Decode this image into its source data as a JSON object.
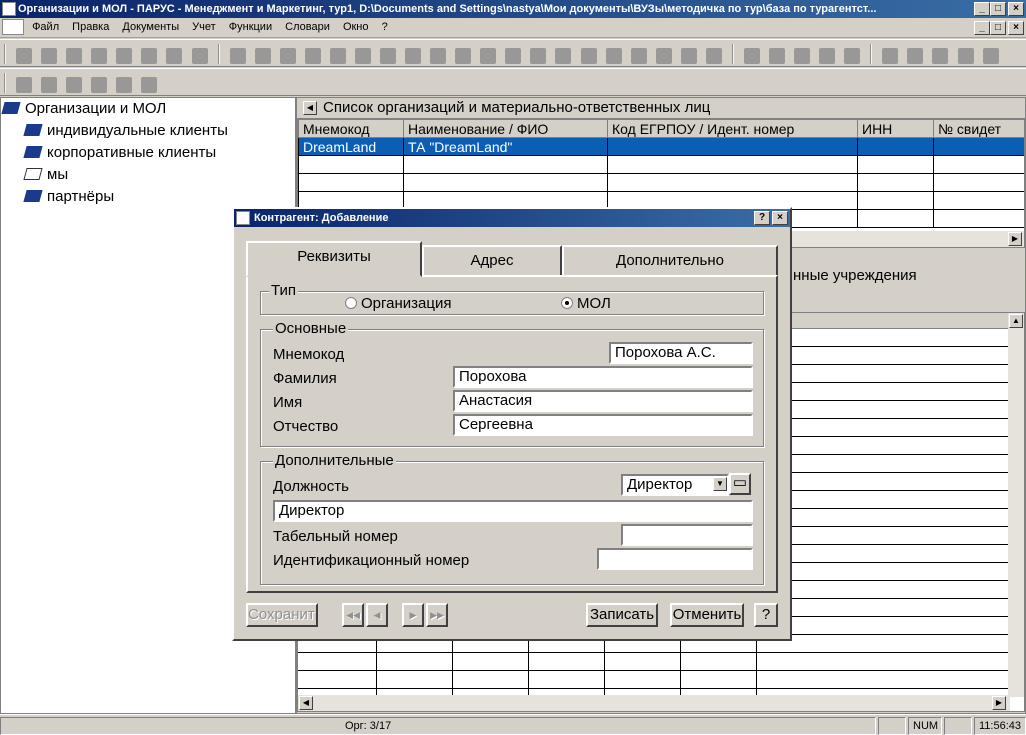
{
  "window": {
    "title": "Организации и МОЛ - ПАРУС - Менеджмент и Маркетинг, тур1, D:\\Documents and Settings\\nastya\\Мои документы\\ВУЗы\\методичка по тур\\база по турагентст..."
  },
  "menu": [
    "Файл",
    "Правка",
    "Документы",
    "Учет",
    "Функции",
    "Словари",
    "Окно",
    "?"
  ],
  "tree": {
    "root": "Организации и МОЛ",
    "items": [
      "индивидуальные клиенты",
      "корпоративные клиенты",
      "мы",
      "партнёры"
    ]
  },
  "top_panel": {
    "title": "Список организаций и материально-ответственных лиц",
    "columns": [
      "Мнемокод",
      "Наименование / ФИО",
      "Код ЕГРПОУ / Идент. номер",
      "ИНН",
      "№ свидет"
    ],
    "rows": [
      [
        "DreamLand",
        "ТА \"DreamLand\"",
        "",
        "",
        ""
      ]
    ]
  },
  "bottom_panel": {
    "title": "нные учреждения"
  },
  "dialog": {
    "title": "Контрагент: Добавление",
    "tabs": [
      "Реквизиты",
      "Адрес",
      "Дополнительно"
    ],
    "type_group": {
      "label": "Тип",
      "option_org": "Организация",
      "option_mol": "МОЛ",
      "selected": "МОЛ"
    },
    "basic_group": {
      "label": "Основные",
      "mnemocode_label": "Мнемокод",
      "mnemocode": "Порохова А.С.",
      "surname_label": "Фамилия",
      "surname": "Порохова",
      "name_label": "Имя",
      "name": "Анастасия",
      "patronymic_label": "Отчество",
      "patronymic": "Сергеевна"
    },
    "extra_group": {
      "label": "Дополнительные",
      "position_label": "Должность",
      "position_select": "Директор",
      "position_text": "Директор",
      "tab_number_label": "Табельный номер",
      "tab_number": "",
      "id_number_label": "Идентификационный номер",
      "id_number": ""
    },
    "buttons": {
      "save": "Сохранить",
      "record": "Записать",
      "cancel": "Отменить",
      "help": "?"
    }
  },
  "status": {
    "record": "Орг: 3/17",
    "num": "NUM",
    "time": "11:56:43"
  }
}
